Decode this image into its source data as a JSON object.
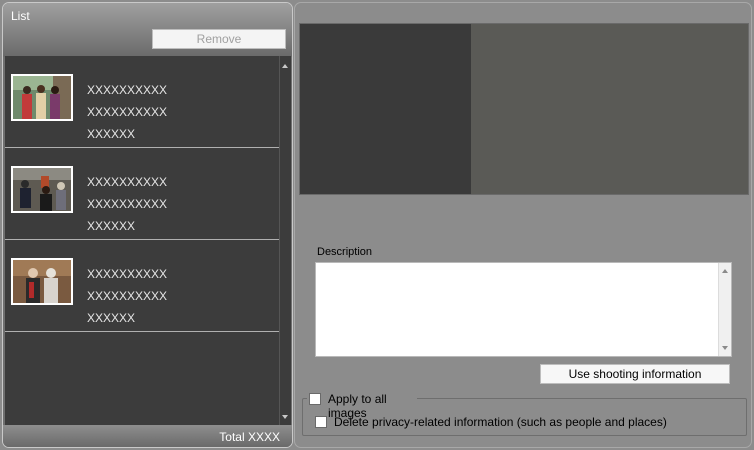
{
  "list_panel": {
    "title": "List",
    "remove_label": "Remove",
    "items": [
      {
        "line1": "XXXXXXXXXX",
        "line2": "XXXXXXXXXX",
        "line3": "XXXXXX"
      },
      {
        "line1": "XXXXXXXXXX",
        "line2": "XXXXXXXXXX",
        "line3": "XXXXXX"
      },
      {
        "line1": "XXXXXXXXXX",
        "line2": "XXXXXXXXXX",
        "line3": "XXXXXX"
      }
    ],
    "total_label": "Total XXXX"
  },
  "detail_panel": {
    "description_label": "Description",
    "description_value": "",
    "use_shooting_label": "Use shooting information",
    "apply_all_label": "Apply to all images",
    "delete_privacy_label": "Delete privacy-related information (such as people and places)"
  },
  "colors": {
    "list_background": "#3c3c3c",
    "panel_background": "#8c8c8c",
    "preview_dark": "#3a3a3a",
    "preview_mid": "#5a5a56"
  }
}
